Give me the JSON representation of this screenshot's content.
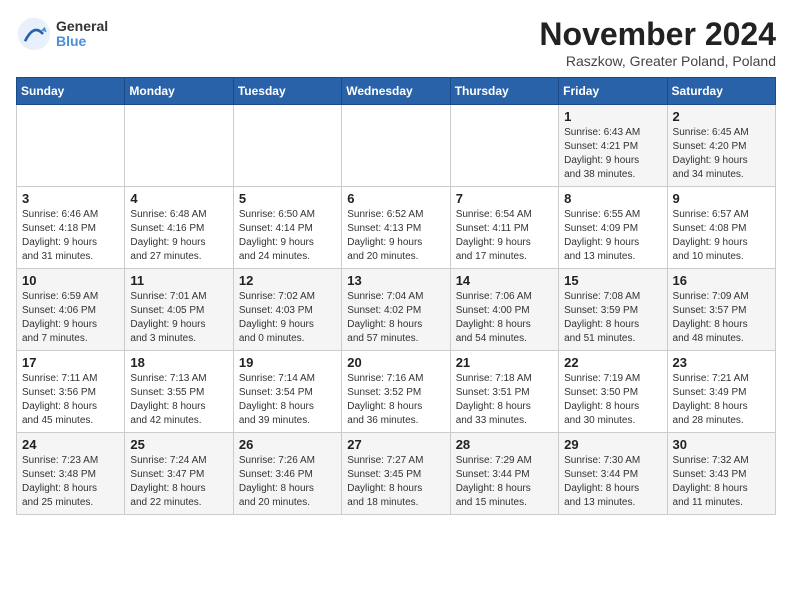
{
  "logo": {
    "line1": "General",
    "line2": "Blue"
  },
  "title": "November 2024",
  "location": "Raszkow, Greater Poland, Poland",
  "days_of_week": [
    "Sunday",
    "Monday",
    "Tuesday",
    "Wednesday",
    "Thursday",
    "Friday",
    "Saturday"
  ],
  "weeks": [
    [
      {
        "day": "",
        "info": ""
      },
      {
        "day": "",
        "info": ""
      },
      {
        "day": "",
        "info": ""
      },
      {
        "day": "",
        "info": ""
      },
      {
        "day": "",
        "info": ""
      },
      {
        "day": "1",
        "info": "Sunrise: 6:43 AM\nSunset: 4:21 PM\nDaylight: 9 hours\nand 38 minutes."
      },
      {
        "day": "2",
        "info": "Sunrise: 6:45 AM\nSunset: 4:20 PM\nDaylight: 9 hours\nand 34 minutes."
      }
    ],
    [
      {
        "day": "3",
        "info": "Sunrise: 6:46 AM\nSunset: 4:18 PM\nDaylight: 9 hours\nand 31 minutes."
      },
      {
        "day": "4",
        "info": "Sunrise: 6:48 AM\nSunset: 4:16 PM\nDaylight: 9 hours\nand 27 minutes."
      },
      {
        "day": "5",
        "info": "Sunrise: 6:50 AM\nSunset: 4:14 PM\nDaylight: 9 hours\nand 24 minutes."
      },
      {
        "day": "6",
        "info": "Sunrise: 6:52 AM\nSunset: 4:13 PM\nDaylight: 9 hours\nand 20 minutes."
      },
      {
        "day": "7",
        "info": "Sunrise: 6:54 AM\nSunset: 4:11 PM\nDaylight: 9 hours\nand 17 minutes."
      },
      {
        "day": "8",
        "info": "Sunrise: 6:55 AM\nSunset: 4:09 PM\nDaylight: 9 hours\nand 13 minutes."
      },
      {
        "day": "9",
        "info": "Sunrise: 6:57 AM\nSunset: 4:08 PM\nDaylight: 9 hours\nand 10 minutes."
      }
    ],
    [
      {
        "day": "10",
        "info": "Sunrise: 6:59 AM\nSunset: 4:06 PM\nDaylight: 9 hours\nand 7 minutes."
      },
      {
        "day": "11",
        "info": "Sunrise: 7:01 AM\nSunset: 4:05 PM\nDaylight: 9 hours\nand 3 minutes."
      },
      {
        "day": "12",
        "info": "Sunrise: 7:02 AM\nSunset: 4:03 PM\nDaylight: 9 hours\nand 0 minutes."
      },
      {
        "day": "13",
        "info": "Sunrise: 7:04 AM\nSunset: 4:02 PM\nDaylight: 8 hours\nand 57 minutes."
      },
      {
        "day": "14",
        "info": "Sunrise: 7:06 AM\nSunset: 4:00 PM\nDaylight: 8 hours\nand 54 minutes."
      },
      {
        "day": "15",
        "info": "Sunrise: 7:08 AM\nSunset: 3:59 PM\nDaylight: 8 hours\nand 51 minutes."
      },
      {
        "day": "16",
        "info": "Sunrise: 7:09 AM\nSunset: 3:57 PM\nDaylight: 8 hours\nand 48 minutes."
      }
    ],
    [
      {
        "day": "17",
        "info": "Sunrise: 7:11 AM\nSunset: 3:56 PM\nDaylight: 8 hours\nand 45 minutes."
      },
      {
        "day": "18",
        "info": "Sunrise: 7:13 AM\nSunset: 3:55 PM\nDaylight: 8 hours\nand 42 minutes."
      },
      {
        "day": "19",
        "info": "Sunrise: 7:14 AM\nSunset: 3:54 PM\nDaylight: 8 hours\nand 39 minutes."
      },
      {
        "day": "20",
        "info": "Sunrise: 7:16 AM\nSunset: 3:52 PM\nDaylight: 8 hours\nand 36 minutes."
      },
      {
        "day": "21",
        "info": "Sunrise: 7:18 AM\nSunset: 3:51 PM\nDaylight: 8 hours\nand 33 minutes."
      },
      {
        "day": "22",
        "info": "Sunrise: 7:19 AM\nSunset: 3:50 PM\nDaylight: 8 hours\nand 30 minutes."
      },
      {
        "day": "23",
        "info": "Sunrise: 7:21 AM\nSunset: 3:49 PM\nDaylight: 8 hours\nand 28 minutes."
      }
    ],
    [
      {
        "day": "24",
        "info": "Sunrise: 7:23 AM\nSunset: 3:48 PM\nDaylight: 8 hours\nand 25 minutes."
      },
      {
        "day": "25",
        "info": "Sunrise: 7:24 AM\nSunset: 3:47 PM\nDaylight: 8 hours\nand 22 minutes."
      },
      {
        "day": "26",
        "info": "Sunrise: 7:26 AM\nSunset: 3:46 PM\nDaylight: 8 hours\nand 20 minutes."
      },
      {
        "day": "27",
        "info": "Sunrise: 7:27 AM\nSunset: 3:45 PM\nDaylight: 8 hours\nand 18 minutes."
      },
      {
        "day": "28",
        "info": "Sunrise: 7:29 AM\nSunset: 3:44 PM\nDaylight: 8 hours\nand 15 minutes."
      },
      {
        "day": "29",
        "info": "Sunrise: 7:30 AM\nSunset: 3:44 PM\nDaylight: 8 hours\nand 13 minutes."
      },
      {
        "day": "30",
        "info": "Sunrise: 7:32 AM\nSunset: 3:43 PM\nDaylight: 8 hours\nand 11 minutes."
      }
    ]
  ]
}
